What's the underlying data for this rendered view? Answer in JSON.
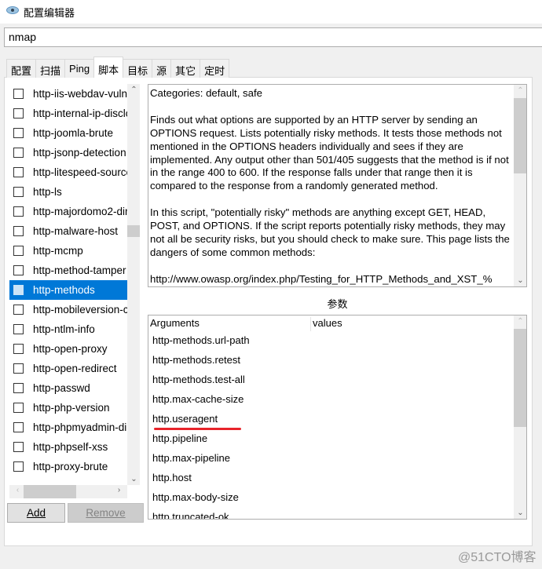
{
  "window": {
    "title": "配置编辑器",
    "icon": "eye-icon"
  },
  "target": {
    "value": "nmap"
  },
  "tabs": [
    {
      "label": "配置"
    },
    {
      "label": "扫描"
    },
    {
      "label": "Ping"
    },
    {
      "label": "脚本",
      "active": true
    },
    {
      "label": "目标"
    },
    {
      "label": "源"
    },
    {
      "label": "其它"
    },
    {
      "label": "定时"
    }
  ],
  "scripts": {
    "selected": "http-methods",
    "items": [
      "http-iis-webdav-vuln",
      "http-internal-ip-disclo",
      "http-joomla-brute",
      "http-jsonp-detection",
      "http-litespeed-source",
      "http-ls",
      "http-majordomo2-dir",
      "http-malware-host",
      "http-mcmp",
      "http-method-tamper",
      "http-methods",
      "http-mobileversion-c",
      "http-ntlm-info",
      "http-open-proxy",
      "http-open-redirect",
      "http-passwd",
      "http-php-version",
      "http-phpmyadmin-dir",
      "http-phpself-xss",
      "http-proxy-brute"
    ]
  },
  "buttons": {
    "add": "Add",
    "remove": "Remove"
  },
  "description": {
    "paragraphs": [
      "Categories: default, safe",
      "Finds out what options are supported by an HTTP server by sending an OPTIONS request. Lists potentially risky methods. It tests those methods not mentioned in the OPTIONS headers individually and sees if they are implemented. Any output other than 501/405 suggests that the method is if not in the range 400 to 600. If the response falls under that range then it is compared to the response from a randomly generated method.",
      "In this script, \"potentially risky\" methods are anything except GET, HEAD, POST, and OPTIONS. If the script reports potentially risky methods, they may not all be security risks, but you should check to make sure. This page lists the dangers of some common methods:",
      "http://www.owasp.org/index.php/Testing_for_HTTP_Methods_and_XST_%"
    ]
  },
  "arguments": {
    "title": "参数",
    "col_args": "Arguments",
    "col_values": "values",
    "highlighted": "http.useragent",
    "highlight_color": "#e8242b",
    "rows": [
      "http-methods.url-path",
      "http-methods.retest",
      "http-methods.test-all",
      "http.max-cache-size",
      "http.useragent",
      "http.pipeline",
      "http.max-pipeline",
      "http.host",
      "http.max-body-size",
      "http.truncated-ok"
    ]
  },
  "watermark": "@51CTO博客",
  "colors": {
    "selection": "#0078d7",
    "background": "#f0f0f0"
  }
}
